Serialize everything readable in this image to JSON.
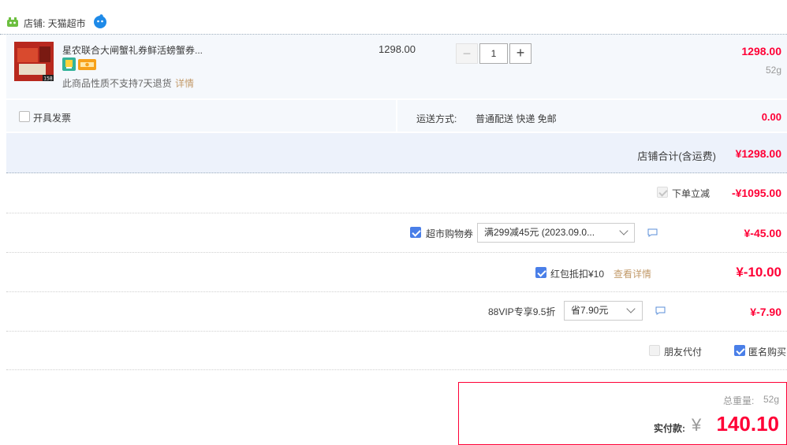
{
  "store": {
    "label": "店铺: 天猫超市"
  },
  "item": {
    "title": "星农联合大闸蟹礼券鲜活螃蟹券...",
    "note": "此商品性质不支持7天退货",
    "note_link": "详情",
    "unit_price": "1298.00",
    "quantity": "1",
    "subtotal": "1298.00",
    "weight": "52g",
    "thumb_badge": "158"
  },
  "invoice": {
    "label": "开具发票"
  },
  "shipping": {
    "label": "运送方式:",
    "method": "普通配送 快递 免邮",
    "fee": "0.00"
  },
  "store_total": {
    "label": "店铺合计(含运费)",
    "amount": "¥1298.00"
  },
  "discounts": {
    "instant": {
      "label": "下单立减",
      "amount": "-¥1095.00"
    },
    "coupon": {
      "label": "超市购物券",
      "selected": "满299减45元 (2023.09.0...",
      "amount": "¥-45.00"
    },
    "redpacket": {
      "label": "红包抵扣¥10",
      "link": "查看详情",
      "amount": "¥-10.00"
    },
    "vip": {
      "label": "88VIP专享9.5折",
      "selected": "省7.90元",
      "amount": "¥-7.90"
    }
  },
  "options": {
    "friend_pay": "朋友代付",
    "anonymous": "匿名购买"
  },
  "payment": {
    "weight_label": "总重量:",
    "weight": "52g",
    "label": "实付款:",
    "currency": "¥",
    "amount": "140.10"
  },
  "colors": {
    "accent": "#ff0036",
    "check": "#4a7fe8",
    "row_bg": "#f5f8fc"
  }
}
